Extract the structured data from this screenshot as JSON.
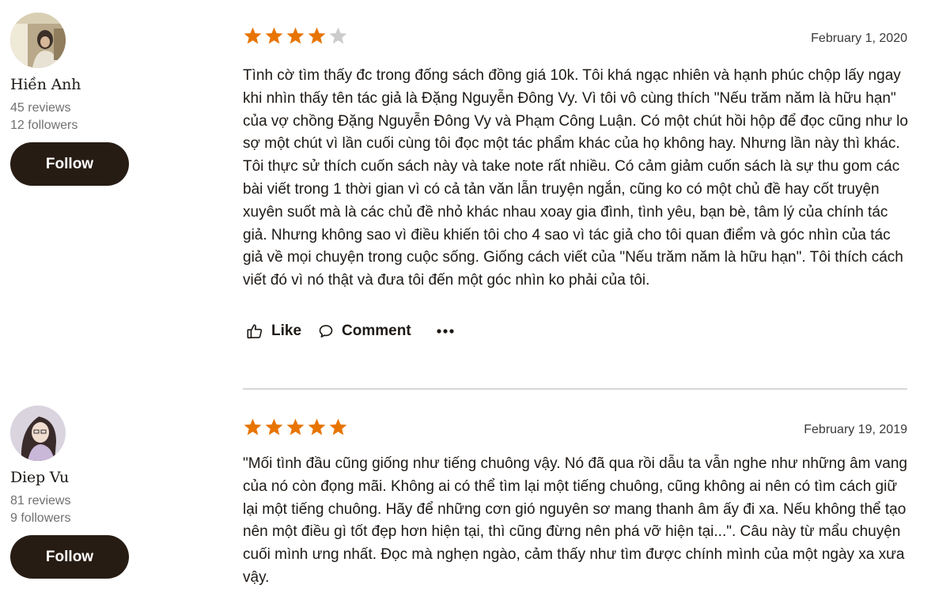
{
  "reviews": [
    {
      "reviewer": {
        "name": "Hiền Anh",
        "reviews_count": "45 reviews",
        "followers": "12 followers",
        "follow_label": "Follow"
      },
      "rating": 4,
      "date": "February 1, 2020",
      "text": "Tình cờ tìm thấy đc trong đống sách đồng giá 10k. Tôi khá ngạc nhiên và hạnh phúc chộp lấy ngay khi nhìn thấy tên tác giả là Đặng Nguyễn Đông Vy. Vì tôi vô cùng thích \"Nếu trăm năm là hữu hạn\" của vợ chồng Đặng Nguyễn Đông Vy và Phạm Công Luận. Có một chút hồi hộp để đọc cũng như lo sợ một chút vì lần cuối cùng tôi đọc một tác phẩm khác của họ không hay. Nhưng lần này thì khác. Tôi thực sử thích cuốn sách này và take note rất nhiều. Có cảm giảm cuốn sách là sự thu gom các bài viết trong 1 thời gian vì có cả tản văn lẫn truyện ngắn, cũng ko có một chủ đề hay cốt truyện xuyên suốt mà là các chủ đề nhỏ khác nhau xoay gia đình, tình yêu, bạn bè, tâm lý của chính tác giả. Nhưng không sao vì điều khiến tôi cho 4 sao vì tác giả cho tôi quan điểm và góc nhìn của tác giả về mọi chuyện trong cuộc sống. Giống cách viết của \"Nếu trăm năm là hữu hạn\". Tôi thích cách viết đó vì nó thật và đưa tôi đến một góc nhìn ko phải của tôi.",
      "actions": {
        "like": "Like",
        "comment": "Comment"
      }
    },
    {
      "reviewer": {
        "name": "Diep Vu",
        "reviews_count": "81 reviews",
        "followers": "9 followers",
        "follow_label": "Follow"
      },
      "rating": 5,
      "date": "February 19, 2019",
      "text": "\"Mối tình đầu cũng giống như tiếng chuông vậy. Nó đã qua rồi dẫu ta vẫn nghe như những âm vang của nó còn đọng mãi. Không ai có thể tìm lại một tiếng chuông, cũng không ai nên có tìm cách giữ lại một tiếng chuông. Hãy để những cơn gió nguyên sơ mang thanh âm ấy đi xa. Nếu không thể tạo nên một điều gì tốt đẹp hơn hiện tại, thì cũng đừng nên phá vỡ hiện tại...\". Câu này từ mẩu chuyện cuối mình ưng nhất. Đọc mà nghẹn ngào, cảm thấy như tìm được chính mình của một ngày xa xưa vậy."
    }
  ],
  "colors": {
    "star_filled": "#e87400",
    "star_empty": "#cccccc",
    "follow_bg": "#271c14",
    "divider": "#d8d8d8"
  },
  "icons": [
    "star-icon",
    "thumbs-up-icon",
    "comment-icon",
    "more-options-icon"
  ]
}
